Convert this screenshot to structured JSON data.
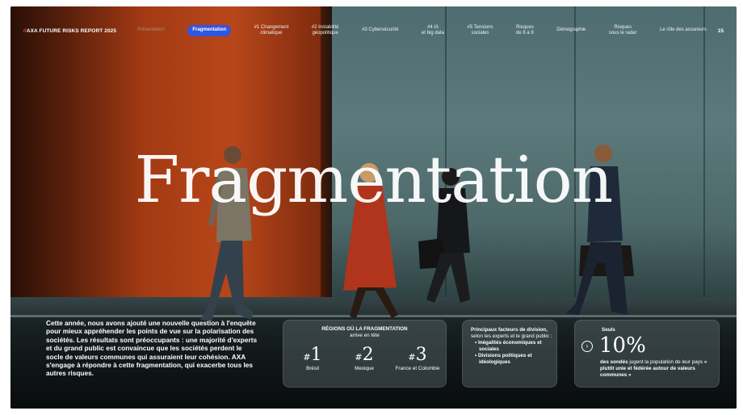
{
  "nav": {
    "brand_slash": "//",
    "brand": "AXA FUTURE RISKS REPORT 2025",
    "items": [
      {
        "label": "Présentation",
        "state": "dim"
      },
      {
        "label": "Fragmentation",
        "state": "active"
      },
      {
        "label": "#1 Changement\nclimatique",
        "state": "normal"
      },
      {
        "label": "#2 Instabilité\ngéopolitique",
        "state": "normal"
      },
      {
        "label": "#3 Cybersécurité",
        "state": "normal"
      },
      {
        "label": "#4 IA\net big data",
        "state": "normal"
      },
      {
        "label": "#5 Tensions\nsociales",
        "state": "normal"
      },
      {
        "label": "Risques\nde 6 à 9",
        "state": "normal"
      },
      {
        "label": "Démographie",
        "state": "normal"
      },
      {
        "label": "Risques\nsous le radar",
        "state": "normal"
      },
      {
        "label": "Le rôle des assureurs",
        "state": "normal"
      }
    ],
    "page_number": "15"
  },
  "hero": {
    "title": "Fragmentation"
  },
  "intro": {
    "text": "Cette année, nous avons ajouté une nouvelle question à l'enquête pour mieux appréhender les points de vue sur la polarisation des sociétés. Les résultats sont préoccupants : une majorité d'experts et du grand public est convaincue que les sociétés perdent le socle de valeurs communes qui assuraient leur cohésion. AXA s'engage à répondre à cette fragmentation, qui exacerbe tous les autres risques."
  },
  "regions_card": {
    "title": "RÉGIONS OÙ LA FRAGMENTATION",
    "subtitle": "arrive en tête",
    "ranks": [
      {
        "hash": "#",
        "num": "1",
        "country": "Brésil"
      },
      {
        "hash": "#",
        "num": "2",
        "country": "Mexique"
      },
      {
        "hash": "#",
        "num": "3",
        "country": "France et Colombie"
      }
    ]
  },
  "factors_card": {
    "title_bold": "Principaux facteurs de division,",
    "title_rest": " selon les experts et le grand public :",
    "items": [
      "• Inégalités économiques et sociales",
      "• Divisions politiques et idéologiques"
    ]
  },
  "stat_card": {
    "lead": "Seuls",
    "icon": "arrow-circle-icon",
    "icon_glyph": "›",
    "percent": "10%",
    "text_bold": "des sondés",
    "text_mid": " jugent la population de leur pays ",
    "text_bold2": "« plutôt unie et fédérée autour de valeurs communes »"
  },
  "colors": {
    "active_tab": "#3156e0",
    "brand_slash": "#e8542e",
    "orange_wall": "#b8461a",
    "teal_wall": "#5c7a7c"
  }
}
